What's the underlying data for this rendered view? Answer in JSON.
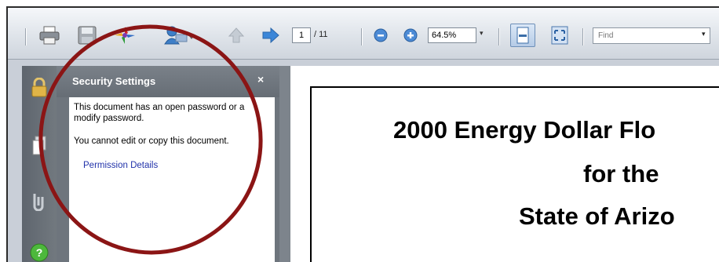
{
  "toolbar": {
    "page_current": "1",
    "page_total": "/ 11",
    "zoom_value": "64.5%",
    "find_placeholder": "Find",
    "dropdown_glyph": "▾"
  },
  "nav_icons": [
    "lock-icon",
    "pages-icon",
    "attachments-icon",
    "help-icon"
  ],
  "panel": {
    "title": "Security Settings",
    "close": "×",
    "line1": "This document has an open password or a modify password.",
    "line2": "You cannot edit or copy this document.",
    "link": "Permission Details"
  },
  "document": {
    "title_line1": "2000 Energy Dollar Flo",
    "title_line2": "for the",
    "title_line3": "State of Arizo"
  },
  "colors": {
    "annotation_circle": "#8b1515",
    "panel_bg": "#6e757d",
    "link": "#2233aa"
  }
}
